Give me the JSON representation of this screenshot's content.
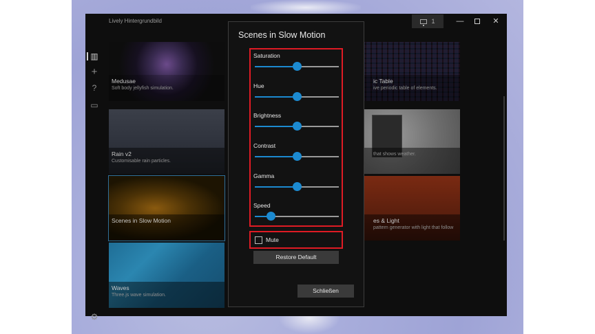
{
  "window": {
    "title": "Lively Hintergrundbild",
    "monitor_count": "1",
    "min_label": "—",
    "close_label": "✕"
  },
  "sidebar": {
    "icons": [
      "library-icon",
      "add-icon",
      "help-icon",
      "feedback-icon",
      "settings-icon"
    ]
  },
  "library": {
    "cards": [
      {
        "title": "Medusae",
        "desc": "Soft body jellyfish simulation."
      },
      {
        "title": "Rain v2",
        "desc": "Customisable rain particles."
      },
      {
        "title": "Scenes in Slow Motion",
        "desc": ""
      },
      {
        "title": "Waves",
        "desc": "Three.js wave simulation."
      },
      {
        "title": "ic Table",
        "desc": "ive periodic table of elements."
      },
      {
        "title": "",
        "desc": "that shows weather."
      },
      {
        "title": "es & Light",
        "desc": "pattern generator with light that follow"
      }
    ]
  },
  "dialog": {
    "title": "Scenes in Slow Motion",
    "sliders": [
      {
        "label": "Saturation",
        "value": 0.5
      },
      {
        "label": "Hue",
        "value": 0.5
      },
      {
        "label": "Brightness",
        "value": 0.5
      },
      {
        "label": "Contrast",
        "value": 0.5
      },
      {
        "label": "Gamma",
        "value": 0.5
      },
      {
        "label": "Speed",
        "value": 0.19
      }
    ],
    "mute_label": "Mute",
    "mute_checked": false,
    "restore_label": "Restore Default",
    "close_label": "Schließen"
  },
  "colors": {
    "accent": "#1c8ad0",
    "highlight": "#e01b24"
  }
}
